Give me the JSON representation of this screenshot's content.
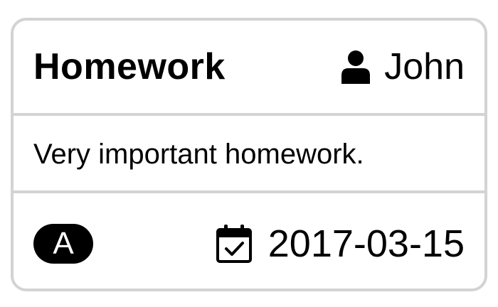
{
  "card": {
    "title": "Homework",
    "assignee": "John",
    "description": "Very important homework.",
    "priority_badge": "A",
    "due_date": "2017-03-15"
  },
  "icons": {
    "assignee": "user-icon",
    "due": "calendar-check-icon"
  },
  "colors": {
    "border": "#d3d3d3",
    "badge_bg": "#000000",
    "badge_text": "#ffffff",
    "text": "#000000"
  }
}
